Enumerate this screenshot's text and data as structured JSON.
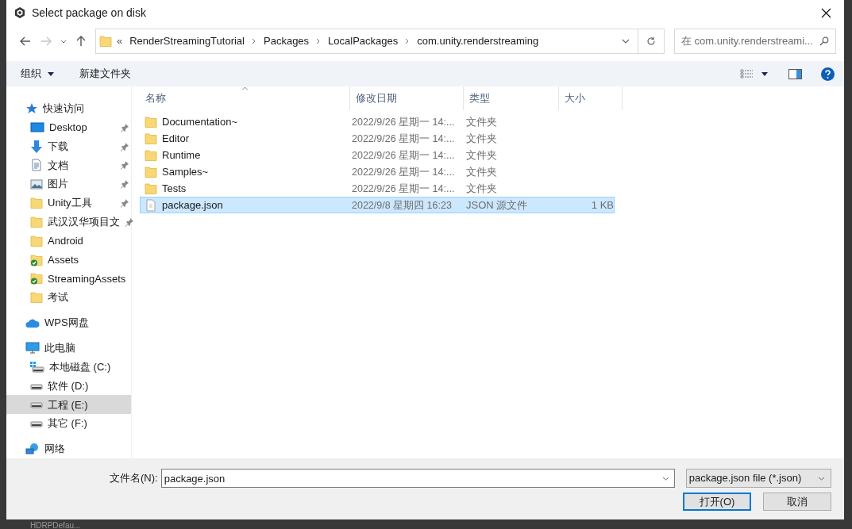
{
  "window": {
    "title": "Select package on disk"
  },
  "address_bar": {
    "overflow": "«",
    "segments": [
      "RenderStreamingTutorial",
      "Packages",
      "LocalPackages",
      "com.unity.renderstreaming"
    ]
  },
  "search": {
    "placeholder": "在 com.unity.renderstreami..."
  },
  "toolbar": {
    "organize": "组织",
    "new_folder": "新建文件夹"
  },
  "sidebar": {
    "items": [
      {
        "label": "快速访问",
        "kind": "star",
        "selected": false,
        "children": [
          {
            "label": "Desktop",
            "kind": "desktop",
            "pinned": true,
            "selected": false
          },
          {
            "label": "下载",
            "kind": "download",
            "pinned": true,
            "selected": false
          },
          {
            "label": "文档",
            "kind": "document",
            "pinned": true,
            "selected": false
          },
          {
            "label": "图片",
            "kind": "pictures",
            "pinned": true,
            "selected": false
          },
          {
            "label": "Unity工具",
            "kind": "folder",
            "pinned": true,
            "selected": false
          },
          {
            "label": "武汉汉华项目文",
            "kind": "folder",
            "pinned": true,
            "selected": false
          },
          {
            "label": "Android",
            "kind": "folder",
            "pinned": false,
            "selected": false
          },
          {
            "label": "Assets",
            "kind": "synced-folder",
            "pinned": false,
            "selected": false
          },
          {
            "label": "StreamingAssets",
            "kind": "synced-folder",
            "pinned": false,
            "selected": false
          },
          {
            "label": "考试",
            "kind": "folder",
            "pinned": false,
            "selected": false
          }
        ]
      },
      {
        "label": "WPS网盘",
        "kind": "cloud",
        "selected": false
      },
      {
        "label": "此电脑",
        "kind": "computer",
        "selected": false,
        "children": [
          {
            "label": "本地磁盘 (C:)",
            "kind": "system-drive",
            "selected": false
          },
          {
            "label": "软件 (D:)",
            "kind": "drive",
            "selected": false
          },
          {
            "label": "工程 (E:)",
            "kind": "drive",
            "selected": true
          },
          {
            "label": "其它 (F:)",
            "kind": "drive",
            "selected": false
          }
        ]
      },
      {
        "label": "网络",
        "kind": "network",
        "selected": false
      }
    ]
  },
  "file_list": {
    "columns": [
      "名称",
      "修改日期",
      "类型",
      "大小"
    ],
    "rows": [
      {
        "name": "Documentation~",
        "modified": "2022/9/26 星期一 14:...",
        "type": "文件夹",
        "kind": "folder",
        "selected": false
      },
      {
        "name": "Editor",
        "modified": "2022/9/26 星期一 14:...",
        "type": "文件夹",
        "kind": "folder",
        "selected": false
      },
      {
        "name": "Runtime",
        "modified": "2022/9/26 星期一 14:...",
        "type": "文件夹",
        "kind": "folder",
        "selected": false
      },
      {
        "name": "Samples~",
        "modified": "2022/9/26 星期一 14:...",
        "type": "文件夹",
        "kind": "folder",
        "selected": false
      },
      {
        "name": "Tests",
        "modified": "2022/9/26 星期一 14:...",
        "type": "文件夹",
        "kind": "folder",
        "selected": false
      },
      {
        "name": "package.json",
        "modified": "2022/9/8 星期四 16:23",
        "type": "JSON 源文件",
        "size": "1 KB",
        "kind": "file",
        "selected": true
      }
    ]
  },
  "footer": {
    "filename_label": "文件名(N):",
    "filename": "package.json",
    "file_type": "package.json file (*.json)",
    "buttons": [
      {
        "label": "打开(O)",
        "default": true
      },
      {
        "label": "取消",
        "default": false
      }
    ]
  },
  "background": {
    "text": "HDRPDefau..."
  }
}
